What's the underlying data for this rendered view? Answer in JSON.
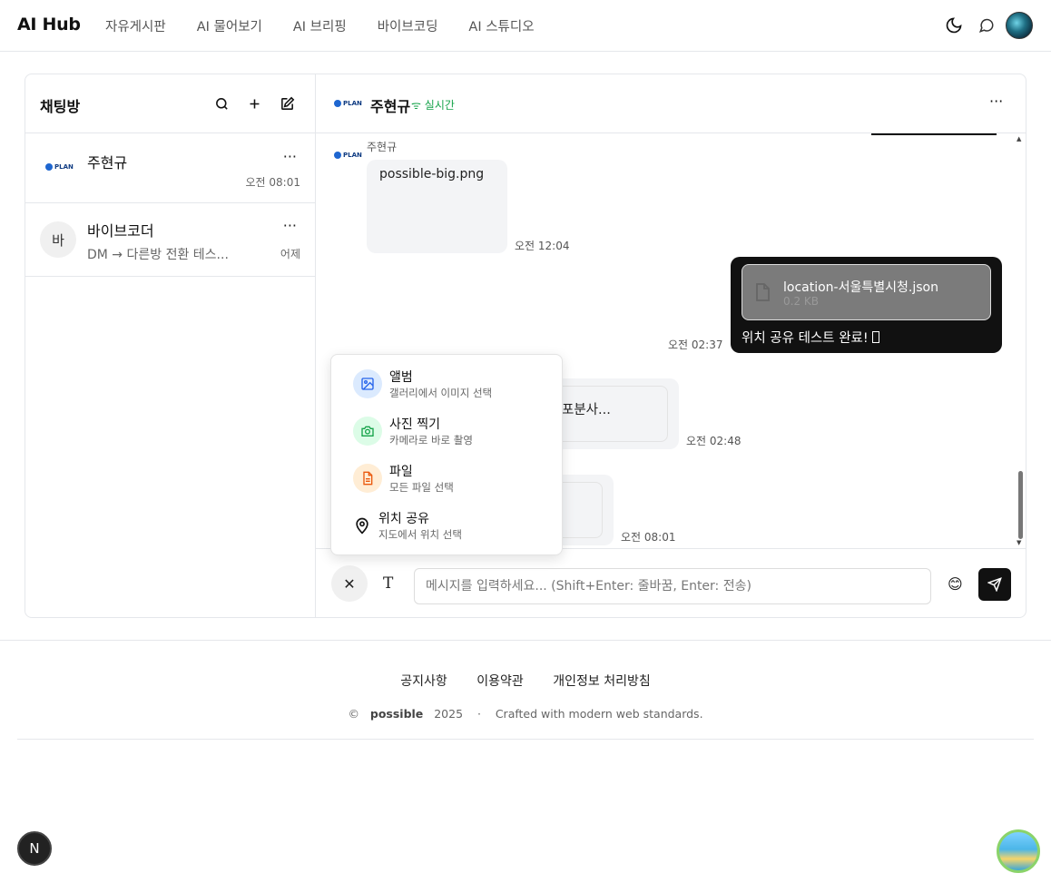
{
  "app": {
    "brand": "AI Hub"
  },
  "nav": {
    "items": [
      "자유게시판",
      "AI 물어보기",
      "AI 브리핑",
      "바이브코딩",
      "AI 스튜디오"
    ]
  },
  "sidebar": {
    "title": "채팅방",
    "rooms": [
      {
        "name": "주현규",
        "time": "오전 08:01",
        "preview": "",
        "avatar_logo": "PLAN"
      },
      {
        "name": "바이브코더",
        "time": "어제",
        "preview": "DM → 다른방 전환 테스...",
        "avatar_initial": "바"
      }
    ]
  },
  "chat": {
    "name": "주현규",
    "status": "실시간",
    "status_icon": "wifi-icon",
    "logo": "PLAN",
    "messages": {
      "m1": {
        "sender": "주현규",
        "image_alt": "possible-big.png",
        "time": "오전 12:04"
      },
      "m2": {
        "file_name": "location-서울특별시청.json",
        "file_size": "0.2 KB",
        "text": "위치 공유 테스트 완료! ",
        "time": "오전 02:37"
      },
      "m3": {
        "text_partial": "포분사...",
        "time": "오전 02:48"
      },
      "m4": {
        "time": "오전 08:01"
      }
    }
  },
  "input": {
    "placeholder": "메시지를 입력하세요... (Shift+Enter: 줄바꿈, Enter: 전송)",
    "close_label": "✕",
    "text_label": "T",
    "emoji": "😊"
  },
  "attach_menu": {
    "items": [
      {
        "title": "앨범",
        "sub": "갤러리에서 이미지 선택",
        "icon": "image-icon",
        "color": "#2563eb",
        "bg": "#dbeafe"
      },
      {
        "title": "사진 찍기",
        "sub": "카메라로 바로 촬영",
        "icon": "camera-icon",
        "color": "#16a34a",
        "bg": "#dcfce7"
      },
      {
        "title": "파일",
        "sub": "모든 파일 선택",
        "icon": "file-icon",
        "color": "#ea580c",
        "bg": "#ffedd5"
      },
      {
        "title": "위치 공유",
        "sub": "지도에서 위치 선택",
        "icon": "map-pin-icon",
        "color": "#111111",
        "bg": "#ffffff"
      }
    ]
  },
  "footer": {
    "links": [
      "공지사항",
      "이용약관",
      "개인정보 처리방침"
    ],
    "copy_symbol": "©",
    "copy_brand": "possible",
    "copy_year": "2025",
    "copy_sep": "·",
    "copy_tagline": "Crafted with modern web standards."
  },
  "badges": {
    "n_label": "N"
  }
}
